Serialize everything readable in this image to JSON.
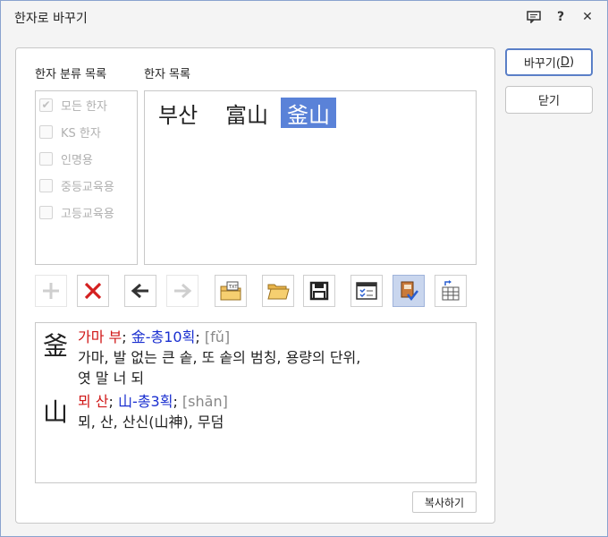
{
  "window": {
    "title": "한자로 바꾸기"
  },
  "titlebar": {
    "help_glyph": "?",
    "close_glyph": "✕"
  },
  "labels": {
    "category": "한자 분류 목록",
    "hanja_list": "한자 목록"
  },
  "categories": [
    {
      "label": "모든 한자",
      "checked": true
    },
    {
      "label": "KS 한자",
      "checked": false
    },
    {
      "label": "인명용",
      "checked": false
    },
    {
      "label": "중등교육용",
      "checked": false
    },
    {
      "label": "고등교육용",
      "checked": false
    }
  ],
  "hanja_items": [
    {
      "text": "부산",
      "selected": false
    },
    {
      "text": "富山",
      "selected": false
    },
    {
      "text": "釜山",
      "selected": true
    }
  ],
  "toolbar": {
    "icons": [
      "add-icon",
      "delete-icon",
      "arrow-left-icon",
      "arrow-right-icon",
      "user-dictionary-icon",
      "open-folder-icon",
      "save-icon",
      "settings-check-icon",
      "book-check-icon",
      "table-import-icon"
    ]
  },
  "info": {
    "chars": [
      {
        "char": "釜",
        "reading": "가마 부",
        "radical": "金",
        "strokes": "총10획",
        "pinyin": "[fǔ]",
        "meaning1": "가마, 발 없는 큰 솥, 또 솥의 범칭, 용량의 단위,",
        "meaning2": "엿 말 너 되"
      },
      {
        "char": "山",
        "reading": "뫼 산",
        "radical": "山",
        "strokes": "총3획",
        "pinyin": "[shān]",
        "meaning1": "뫼, 산, 산신(山神), 무덤"
      }
    ]
  },
  "buttons": {
    "copy": "복사하기",
    "replace_label": "바꾸기(",
    "replace_key": "D",
    "replace_end": ")",
    "close": "닫기"
  },
  "colors": {
    "selection": "#5a82d8",
    "reading": "#d01818",
    "radical": "#1a2fd0",
    "pinyin": "#888888"
  }
}
